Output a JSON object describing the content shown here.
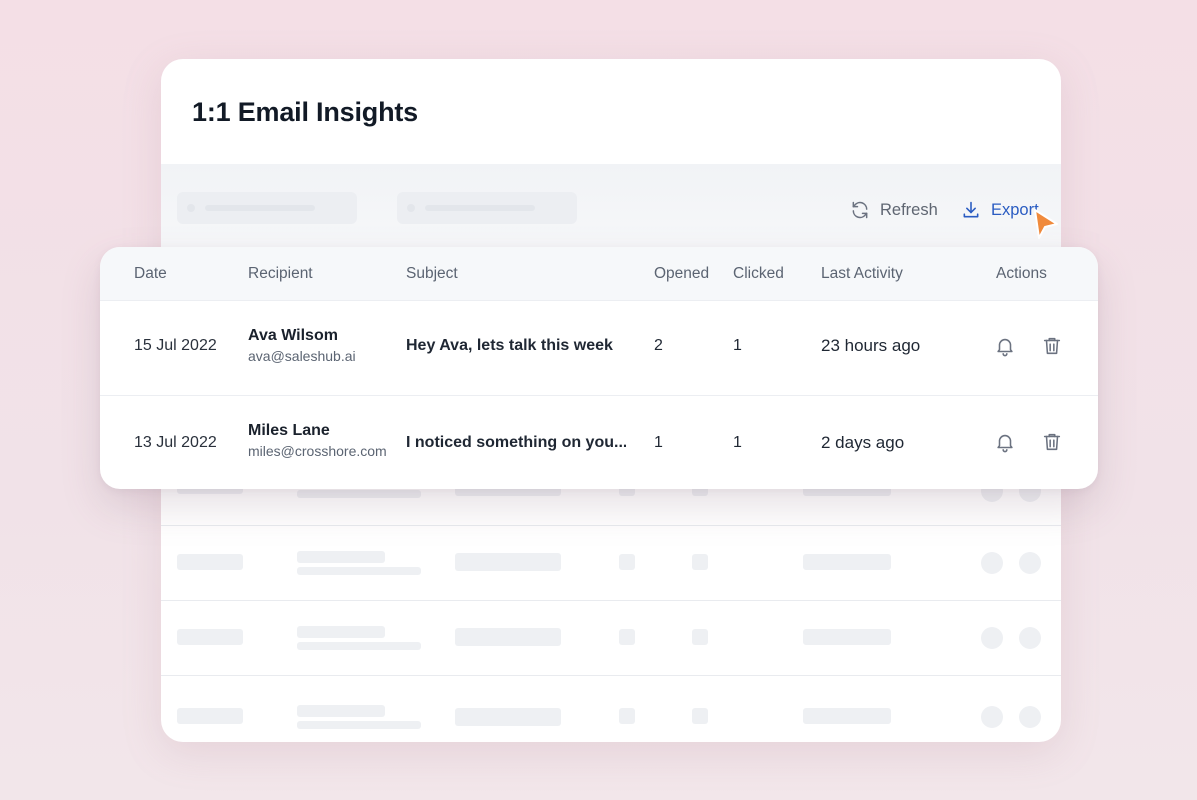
{
  "card": {
    "title": "1:1 Email Insights"
  },
  "toolbar": {
    "refresh_label": "Refresh",
    "export_label": "Export",
    "refresh_icon": "refresh-icon",
    "export_icon": "download-icon"
  },
  "table": {
    "columns": [
      "Date",
      "Recipient",
      "Subject",
      "Opened",
      "Clicked",
      "Last Activity",
      "Actions"
    ],
    "rows": [
      {
        "date": "15 Jul 2022",
        "recipient_name": "Ava Wilsom",
        "recipient_email": "ava@saleshub.ai",
        "subject": "Hey Ava, lets talk this week",
        "opened": "2",
        "clicked": "1",
        "last_activity": "23 hours ago"
      },
      {
        "date": "13 Jul 2022",
        "recipient_name": "Miles Lane",
        "recipient_email": "miles@crosshore.com",
        "subject": "I noticed something on you...",
        "opened": "1",
        "clicked": "1",
        "last_activity": "2 days ago"
      }
    ],
    "action_icons": [
      "bell-icon",
      "trash-icon"
    ]
  },
  "colors": {
    "background": "#f4dfe6",
    "accent": "#2a5cc2",
    "cursor": "#f08a3c",
    "title": "#121a26"
  }
}
